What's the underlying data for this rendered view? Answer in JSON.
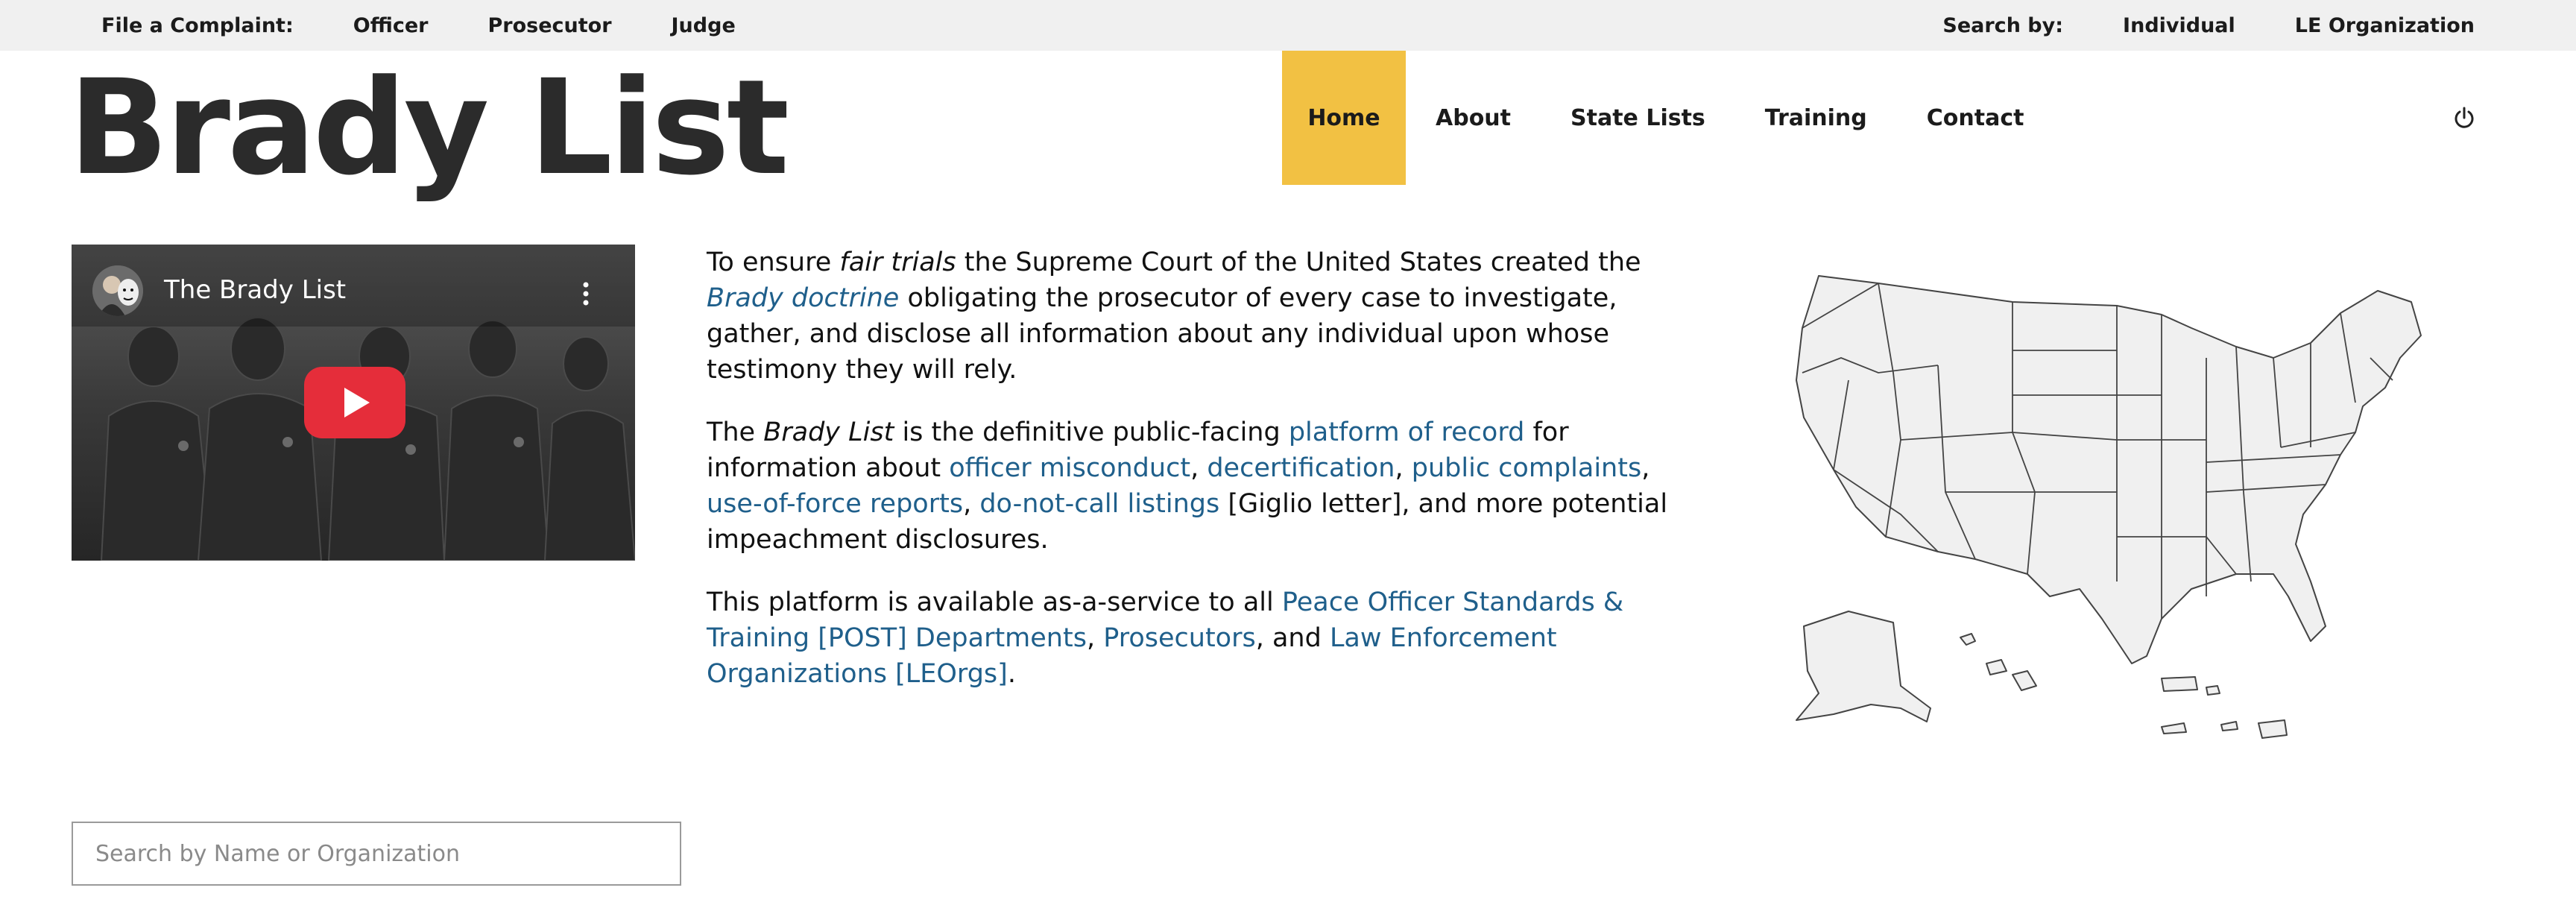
{
  "topbar": {
    "complaint_label": "File a Complaint:",
    "complaint_links": [
      "Officer",
      "Prosecutor",
      "Judge"
    ],
    "search_label": "Search by:",
    "search_links": [
      "Individual",
      "LE Organization"
    ]
  },
  "header": {
    "logo": "Brady List",
    "nav": [
      "Home",
      "About",
      "State Lists",
      "Training",
      "Contact"
    ],
    "active_nav": "Home",
    "power_icon": "power-icon"
  },
  "video": {
    "title": "The Brady List",
    "play_icon": "youtube-play-icon",
    "menu_icon": "more-vertical-icon"
  },
  "content": {
    "p1": {
      "t1": "To ensure ",
      "em1": "fair trials",
      "t2": " the Supreme Court of the United States created the ",
      "link1": "Brady doctrine",
      "t3": " obligating the prosecutor of every case to investigate, gather, and disclose all information about any individual upon whose testimony they will rely."
    },
    "p2": {
      "t1": "The ",
      "em1": "Brady List",
      "t2": " is the definitive public-facing ",
      "link1": "platform of record",
      "t3": " for information about ",
      "link2": "officer misconduct",
      "t4": ", ",
      "link3": "decertification",
      "t5": ", ",
      "link4": "public complaints",
      "t6": ", ",
      "link5": "use-of-force reports",
      "t7": ", ",
      "link6": "do-not-call listings",
      "t8": " [Giglio letter], and more potential impeachment disclosures."
    },
    "p3": {
      "t1": "This platform is available as-a-service to all ",
      "link1": "Peace Officer Standards & Training [POST] Departments",
      "t2": ", ",
      "link2": "Prosecutors",
      "t3": ", and ",
      "link3": "Law Enforcement Organizations [LEOrgs]",
      "t4": "."
    }
  },
  "map": {
    "icon": "us-states-map"
  },
  "search": {
    "placeholder": "Search by Name or Organization",
    "value": ""
  },
  "colors": {
    "accent": "#f2c143",
    "link": "#1f5f8b",
    "topbar_bg": "#f0f0f0",
    "logo": "#2b2b2b"
  }
}
